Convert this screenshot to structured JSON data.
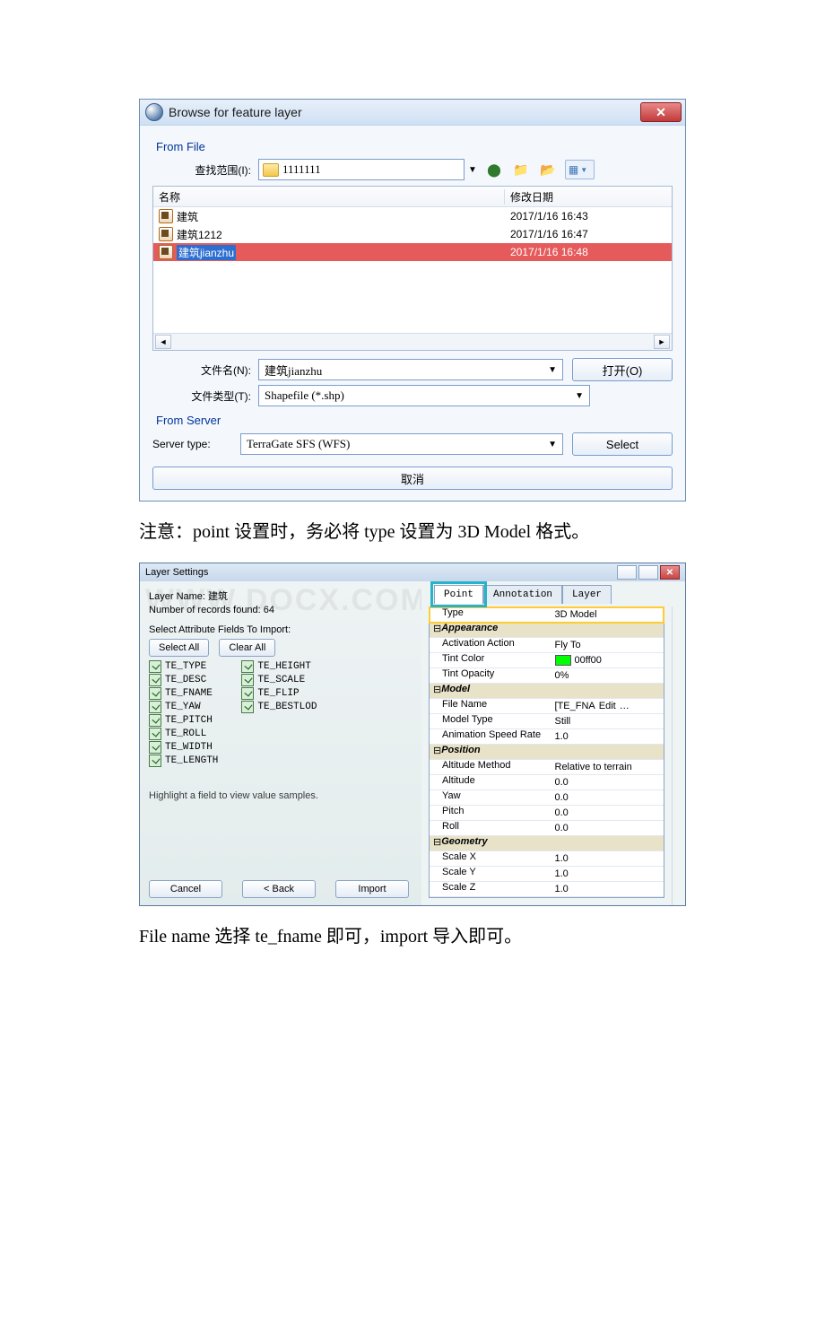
{
  "browse": {
    "title": "Browse for feature layer",
    "fromFile": "From File",
    "lookInLabel": "查找范围(I):",
    "lookInValue": "1111111",
    "col_name": "名称",
    "col_date": "修改日期",
    "rows": [
      {
        "name": "建筑",
        "date": "2017/1/16 16:43"
      },
      {
        "name": "建筑1212",
        "date": "2017/1/16 16:47"
      },
      {
        "name": "建筑jianzhu",
        "date": "2017/1/16 16:48"
      }
    ],
    "fileNameLabel": "文件名(N):",
    "fileNameValue": "建筑jianzhu",
    "fileTypeLabel": "文件类型(T):",
    "fileTypeValue": "Shapefile (*.shp)",
    "openBtn": "打开(O)",
    "fromServer": "From Server",
    "serverTypeLabel": "Server type:",
    "serverTypeValue": "TerraGate SFS (WFS)",
    "selectBtn": "Select",
    "cancelBtn": "取消"
  },
  "para1": "注意：point 设置时，务必将 type 设置为 3D Model 格式。",
  "layer": {
    "title": "Layer Settings",
    "layerNameLabel": "Layer Name:",
    "layerNameValue": "建筑",
    "recordsLabel": "Number of records found:",
    "recordsValue": "64",
    "selectAttrLabel": "Select Attribute Fields To Import:",
    "selectAll": "Select All",
    "clearAll": "Clear All",
    "fieldsL": [
      "TE_TYPE",
      "TE_DESC",
      "TE_FNAME",
      "TE_YAW",
      "TE_PITCH",
      "TE_ROLL",
      "TE_WIDTH",
      "TE_LENGTH"
    ],
    "fieldsR": [
      "TE_HEIGHT",
      "TE_SCALE",
      "TE_FLIP",
      "TE_BESTLOD"
    ],
    "highlightHint": "Highlight a field to view value samples.",
    "cancel": "Cancel",
    "back": "< Back",
    "import": "Import",
    "tabs": {
      "point": "Point",
      "annotation": "Annotation",
      "layerTab": "Layer"
    },
    "grid": {
      "type_k": "Type",
      "type_v": "3D Model",
      "grp_appearance": "Appearance",
      "act_k": "Activation Action",
      "act_v": "Fly To",
      "tint_k": "Tint Color",
      "tint_v": "00ff00",
      "tint_hex": "#00ff00",
      "opac_k": "Tint Opacity",
      "opac_v": "0%",
      "grp_model": "Model",
      "file_k": "File Name",
      "file_v": "[TE_FNA",
      "file_edit": "Edit",
      "mtype_k": "Model Type",
      "mtype_v": "Still",
      "anim_k": "Animation Speed Rate",
      "anim_v": "1.0",
      "grp_position": "Position",
      "altm_k": "Altitude Method",
      "altm_v": "Relative to terrain",
      "alt_k": "Altitude",
      "alt_v": "0.0",
      "yaw_k": "Yaw",
      "yaw_v": "0.0",
      "pitch_k": "Pitch",
      "pitch_v": "0.0",
      "roll_k": "Roll",
      "roll_v": "0.0",
      "grp_geometry": "Geometry",
      "sx_k": "Scale X",
      "sx_v": "1.0",
      "sy_k": "Scale Y",
      "sy_v": "1.0",
      "sz_k": "Scale Z",
      "sz_v": "1.0"
    }
  },
  "para2": "File name 选择 te_fname 即可，import 导入即可。"
}
